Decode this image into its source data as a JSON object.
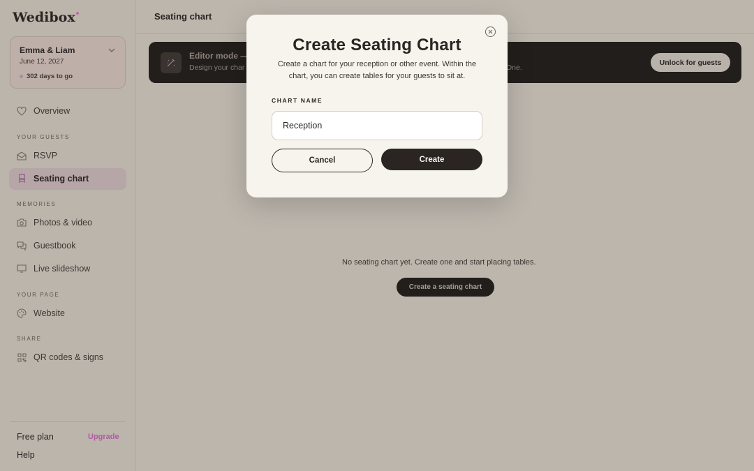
{
  "app": {
    "logo": "Wedibox"
  },
  "event": {
    "name": "Emma & Liam",
    "date": "June 12, 2027",
    "countdown": "302 days to go"
  },
  "sidebar": {
    "overview": "Overview",
    "sections": {
      "guests": "YOUR GUESTS",
      "memories": "MEMORIES",
      "page": "YOUR PAGE",
      "share": "SHARE"
    },
    "items": {
      "rsvp": "RSVP",
      "seating": "Seating chart",
      "photos": "Photos & video",
      "guestbook": "Guestbook",
      "slideshow": "Live slideshow",
      "website": "Website",
      "qr": "QR codes & signs"
    },
    "footer": {
      "plan": "Free plan",
      "upgrade": "Upgrade",
      "help": "Help"
    }
  },
  "header": {
    "title": "Seating chart"
  },
  "editor_bar": {
    "title": "Editor mode —",
    "description": "Design your char",
    "description_tail": "One.",
    "unlock": "Unlock for guests"
  },
  "empty_state": {
    "text": "No seating chart yet. Create one and start placing tables.",
    "button": "Create a seating chart"
  },
  "modal": {
    "title": "Create Seating Chart",
    "description": "Create a chart for your reception or other event. Within the chart, you can create tables for your guests to sit at.",
    "field_label": "CHART NAME",
    "field_value": "Reception",
    "cancel": "Cancel",
    "create": "Create"
  },
  "colors": {
    "accent": "#b25aa4",
    "dark": "#221e1b",
    "modal_bg": "#f7f4ee"
  }
}
